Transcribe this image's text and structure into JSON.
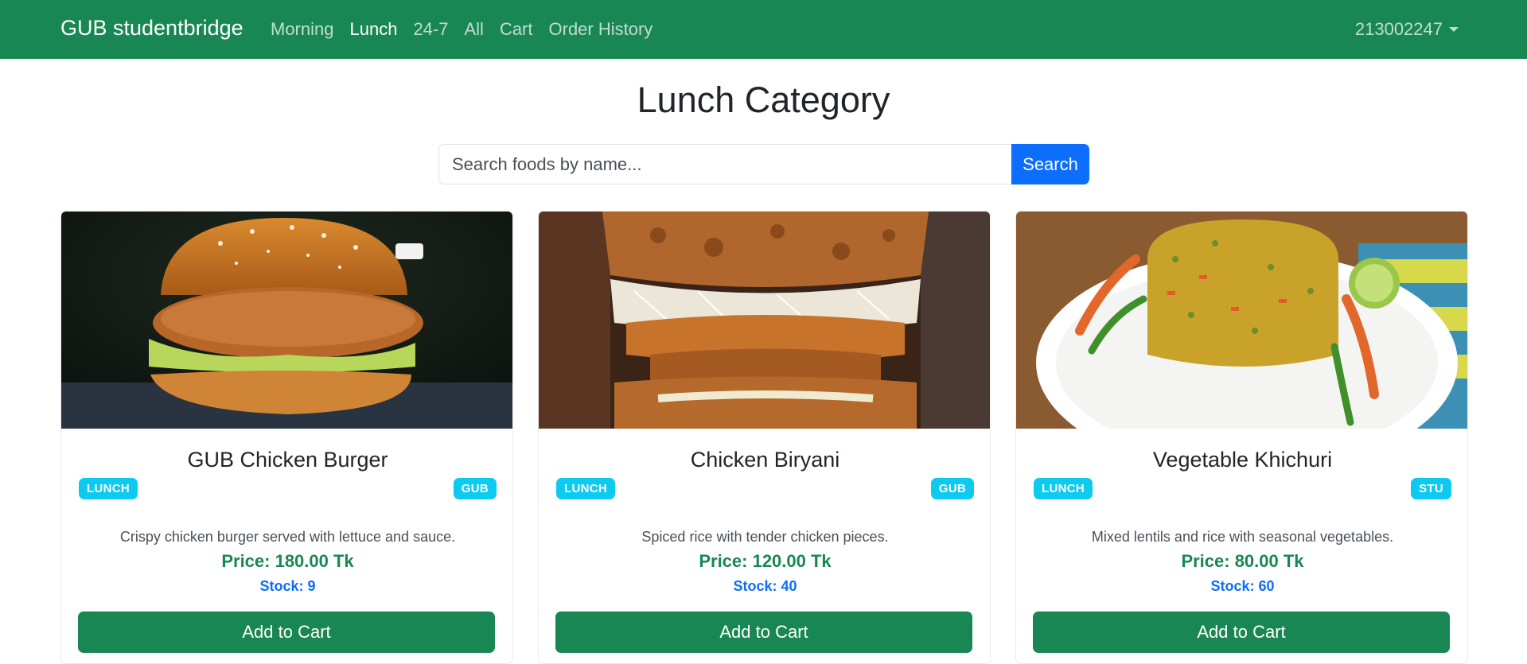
{
  "navbar": {
    "brand": "GUB studentbridge",
    "links": [
      {
        "label": "Morning"
      },
      {
        "label": "Lunch"
      },
      {
        "label": "24-7"
      },
      {
        "label": "All"
      },
      {
        "label": "Cart"
      },
      {
        "label": "Order History"
      }
    ],
    "active_link": "Lunch",
    "user": "213002247"
  },
  "page": {
    "title": "Lunch Category"
  },
  "search": {
    "placeholder": "Search foods by name...",
    "value": "",
    "button_label": "Search"
  },
  "products": [
    {
      "name": "GUB Chicken Burger",
      "category": "LUNCH",
      "vendor": "GUB",
      "description": "Crispy chicken burger served with lettuce and sauce.",
      "price": "Price: 180.00 Tk",
      "stock": "Stock: 9",
      "button_label": "Add to Cart",
      "image_icon": "burger-image"
    },
    {
      "name": "Chicken Biryani",
      "category": "LUNCH",
      "vendor": "GUB",
      "description": "Spiced rice with tender chicken pieces.",
      "price": "Price: 120.00 Tk",
      "stock": "Stock: 40",
      "button_label": "Add to Cart",
      "image_icon": "fried-chicken-sandwich-image"
    },
    {
      "name": "Vegetable Khichuri",
      "category": "LUNCH",
      "vendor": "STU",
      "description": "Mixed lentils and rice with seasonal vegetables.",
      "price": "Price: 80.00 Tk",
      "stock": "Stock: 60",
      "button_label": "Add to Cart",
      "image_icon": "khichuri-plate-image"
    }
  ],
  "colors": {
    "navbar": "#198754",
    "badge": "#0dcaf0",
    "price": "#198754",
    "stock": "#0d6efd",
    "search_button": "#0d6efd",
    "cart_button": "#198754"
  }
}
